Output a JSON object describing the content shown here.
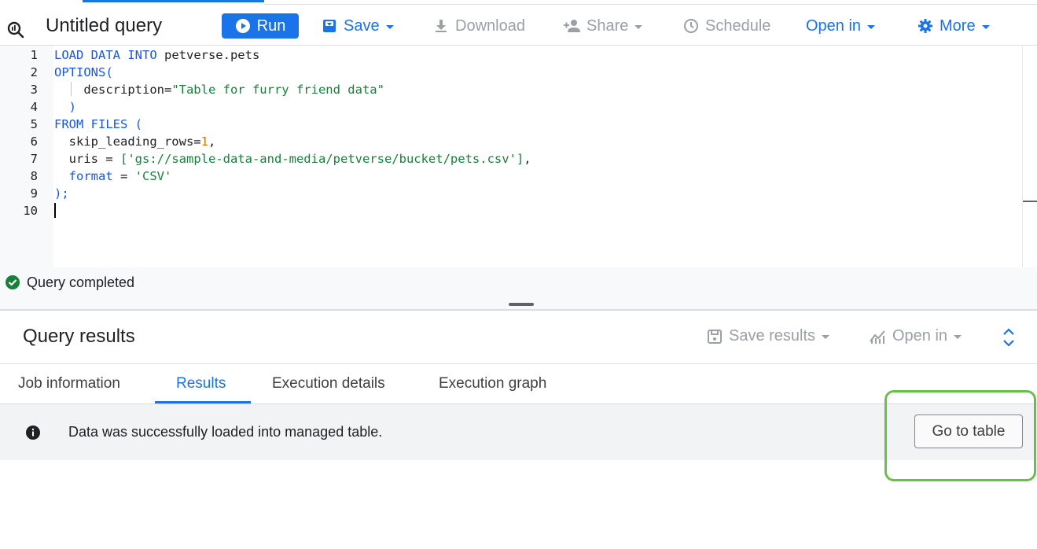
{
  "toolbar": {
    "title": "Untitled query",
    "run_label": "Run",
    "save_label": "Save",
    "download_label": "Download",
    "share_label": "Share",
    "schedule_label": "Schedule",
    "open_in_label": "Open in",
    "more_label": "More"
  },
  "editor": {
    "line_numbers": [
      "1",
      "2",
      "3",
      "4",
      "5",
      "6",
      "7",
      "8",
      "9",
      "10"
    ],
    "lines": [
      {
        "kw1": "LOAD DATA INTO",
        "plain1": " petverse.pets"
      },
      {
        "kw1": "OPTIONS("
      },
      {
        "plain1": "    description=",
        "str1": "\"Table for furry friend data\""
      },
      {
        "kw1": "  )"
      },
      {
        "kw1": "FROM FILES ("
      },
      {
        "plain1": "  skip_leading_rows=",
        "num1": "1",
        "plain2": ","
      },
      {
        "plain1": "  uris = ",
        "str1": "['gs://sample-data-and-media/petverse/bucket/pets.csv']",
        "plain2": ","
      },
      {
        "kw1": "  format",
        "plain1": " = ",
        "str1": "'CSV'"
      },
      {
        "kw1": ");"
      }
    ]
  },
  "status": {
    "text": "Query completed"
  },
  "results": {
    "title": "Query results",
    "save_results_label": "Save results",
    "open_in_label": "Open in",
    "tabs": [
      "Job information",
      "Results",
      "Execution details",
      "Execution graph"
    ],
    "active_tab": "Results",
    "message": "Data was successfully loaded into managed table.",
    "go_to_table_label": "Go to table"
  },
  "colors": {
    "accent": "#1a73e8",
    "highlight": "#6abf4b",
    "success": "#188038"
  }
}
